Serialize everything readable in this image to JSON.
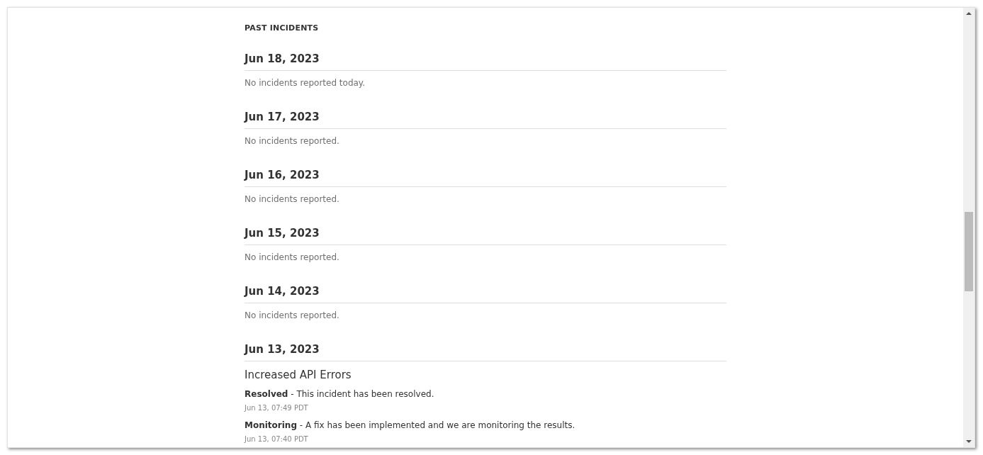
{
  "section_title": "PAST INCIDENTS",
  "days": [
    {
      "date": "Jun 18, 2023",
      "note": "No incidents reported today."
    },
    {
      "date": "Jun 17, 2023",
      "note": "No incidents reported."
    },
    {
      "date": "Jun 16, 2023",
      "note": "No incidents reported."
    },
    {
      "date": "Jun 15, 2023",
      "note": "No incidents reported."
    },
    {
      "date": "Jun 14, 2023",
      "note": "No incidents reported."
    },
    {
      "date": "Jun 13, 2023",
      "incidents": [
        {
          "title": "Increased API Errors",
          "updates": [
            {
              "text": "**Resolved** - This incident has been resolved.",
              "time": "Jun 13, 07:49 PDT"
            },
            {
              "text": "**Monitoring** - A fix has been implemented and we are monitoring the results.",
              "time": "Jun 13, 07:40 PDT"
            }
          ]
        }
      ]
    }
  ]
}
